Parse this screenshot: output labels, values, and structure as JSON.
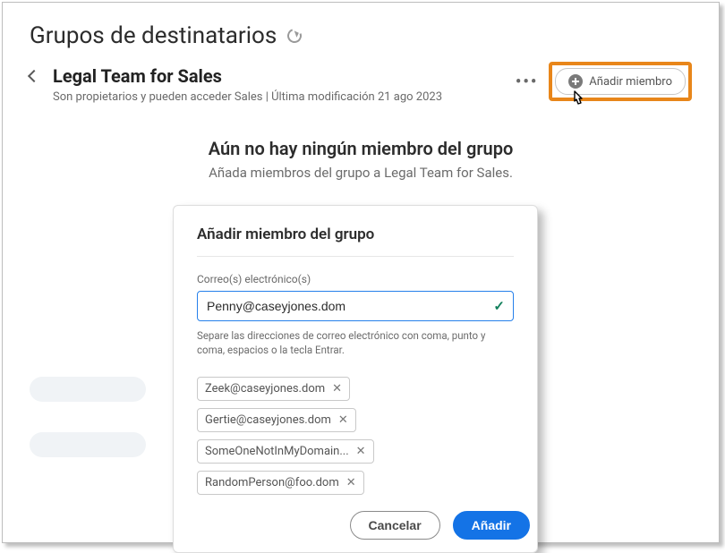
{
  "page": {
    "title": "Grupos de destinatarios"
  },
  "group": {
    "name": "Legal Team for Sales",
    "subtitle": "Son propietarios y pueden acceder Sales | Última modificación 21 ago 2023"
  },
  "header": {
    "add_member_label": "Añadir miembro"
  },
  "empty": {
    "title": "Aún no hay ningún miembro del grupo",
    "subtitle": "Añada miembros del grupo a Legal Team for Sales."
  },
  "modal": {
    "title": "Añadir miembro del grupo",
    "email_label": "Correo(s) electrónico(s)",
    "email_value": "Penny@caseyjones.dom",
    "helper": "Separe las direcciones de correo electrónico con coma, punto y coma, espacios o la tecla Entrar.",
    "chips": [
      "Zeek@caseyjones.dom",
      "Gertie@caseyjones.dom",
      "SomeOneNotInMyDomain...",
      "RandomPerson@foo.dom"
    ],
    "cancel_label": "Cancelar",
    "add_label": "Añadir"
  }
}
